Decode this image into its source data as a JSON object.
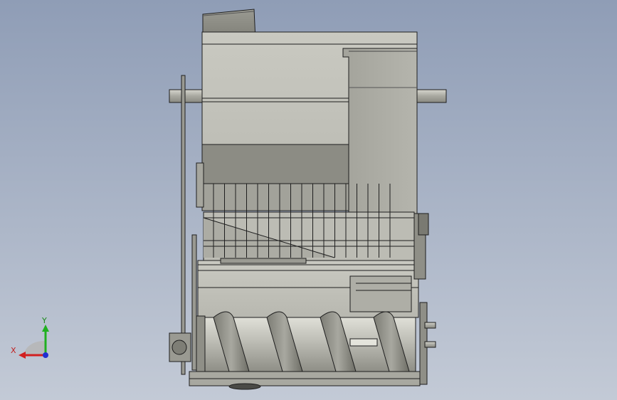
{
  "viewport": {
    "background_top": "#8f9db6",
    "background_bottom": "#c3cad6"
  },
  "model": {
    "body_color": "#c4c4bc",
    "shadow_color": "#8c8c84",
    "edge_color": "#1e1e1e",
    "nameplate_text": ""
  },
  "triad": {
    "x_label": "X",
    "y_label": "Y",
    "x_color": "#d22020",
    "y_color": "#20b020",
    "z_color": "#2030d0"
  }
}
